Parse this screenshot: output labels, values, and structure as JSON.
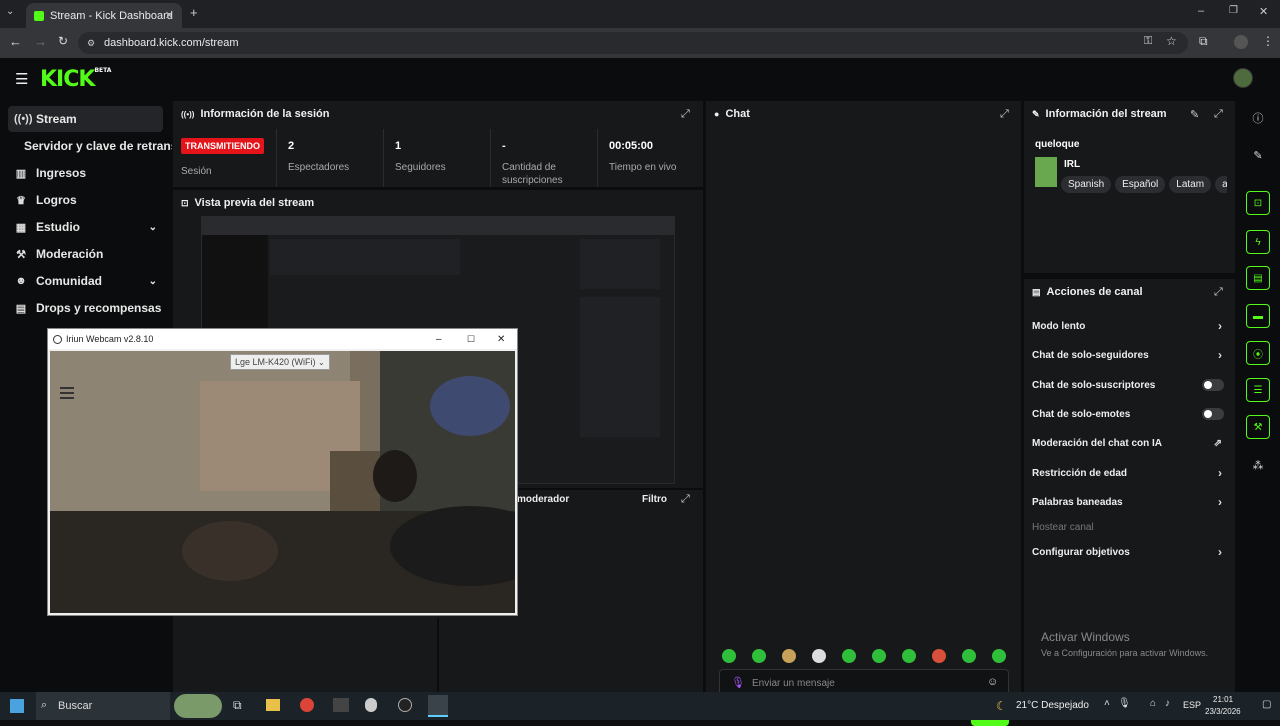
{
  "browser": {
    "tab_title": "Stream - Kick Dashboard",
    "url": "dashboard.kick.com/stream"
  },
  "brand": {
    "logo": "KICK",
    "logo_badge": "BETA",
    "accent": "#53fc18"
  },
  "sidebar": {
    "items": [
      {
        "label": "Stream",
        "icon": "broadcast-icon"
      },
      {
        "label": "Servidor y clave de retransm",
        "icon": ""
      },
      {
        "label": "Ingresos",
        "icon": "bar-chart-icon"
      },
      {
        "label": "Logros",
        "icon": "trophy-icon"
      },
      {
        "label": "Estudio",
        "icon": "layout-icon"
      },
      {
        "label": "Moderación",
        "icon": "wrench-icon"
      },
      {
        "label": "Comunidad",
        "icon": "people-icon"
      },
      {
        "label": "Drops y recompensas",
        "icon": "gift-icon"
      }
    ]
  },
  "session": {
    "title": "Información de la sesión",
    "status_badge": "TRANSMITIENDO",
    "status_label": "Sesión",
    "stats": [
      {
        "value": "2",
        "label": "Espectadores"
      },
      {
        "value": "1",
        "label": "Seguidores"
      },
      {
        "value": "-",
        "label": "Cantidad de suscripciones"
      },
      {
        "value": "00:05:00",
        "label": "Tiempo en vivo"
      }
    ]
  },
  "preview": {
    "title": "Vista previa del stream"
  },
  "mod_panel": {
    "title_partial": "moderador",
    "filter_label": "Filtro"
  },
  "chat": {
    "title": "Chat",
    "input_placeholder": "Enviar un mensaje",
    "send_label": "Chat"
  },
  "stream_info": {
    "title": "Información del stream",
    "stream_title": "queloque",
    "category": "IRL",
    "tags": [
      "Spanish",
      "Español",
      "Latam",
      "an"
    ]
  },
  "channel_actions": {
    "title": "Acciones de canal",
    "items": [
      {
        "label": "Modo lento",
        "control": "chevron"
      },
      {
        "label": "Chat de solo-seguidores",
        "control": "chevron"
      },
      {
        "label": "Chat de solo-suscriptores",
        "control": "toggle"
      },
      {
        "label": "Chat de solo-emotes",
        "control": "toggle"
      },
      {
        "label": "Moderación del chat con IA",
        "control": "external"
      },
      {
        "label": "Restricción de edad",
        "control": "chevron"
      },
      {
        "label": "Palabras baneadas",
        "control": "chevron"
      },
      {
        "label": "Hostear canal",
        "control": "none"
      },
      {
        "label": "Configurar objetivos",
        "control": "chevron"
      }
    ]
  },
  "windows_watermark": {
    "line1": "Activar Windows",
    "line2": "Ve a Configuración para activar Windows."
  },
  "webcam_window": {
    "title": "Iriun Webcam v2.8.10",
    "device": "Lge LM-K420 (WiFi)"
  },
  "taskbar": {
    "search_label": "Buscar",
    "weather": "21°C  Despejado",
    "lang": "ESP",
    "time": "21:01",
    "date": "23/3/2026"
  }
}
